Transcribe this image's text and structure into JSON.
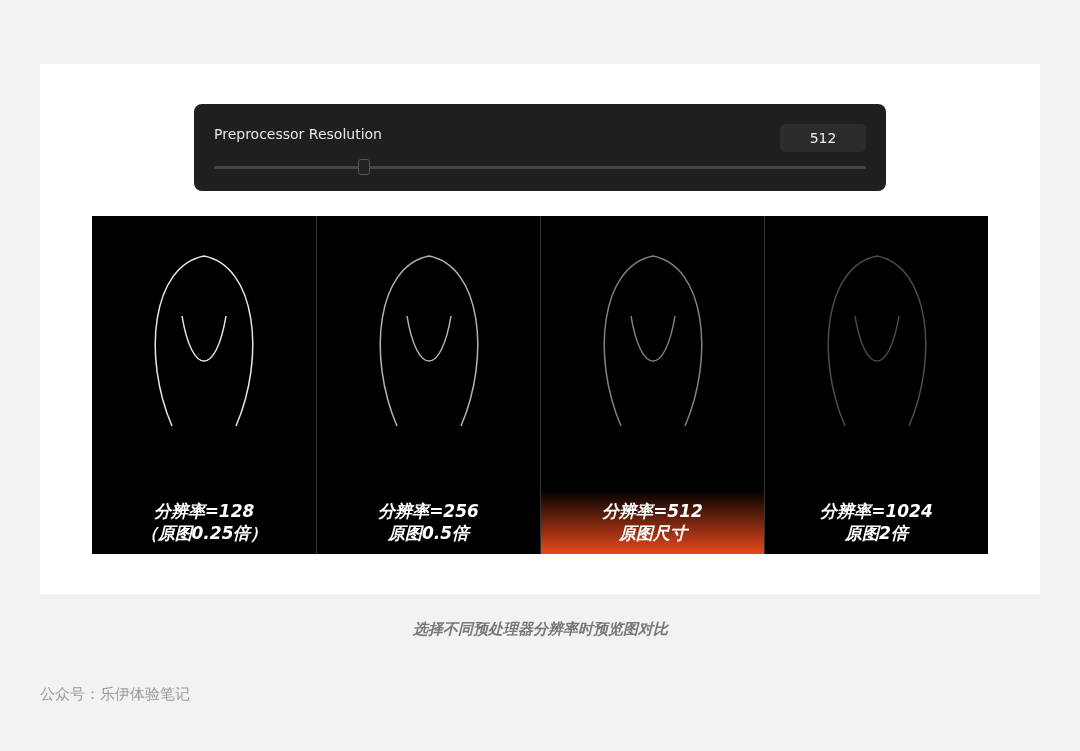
{
  "settings_panel": {
    "label": "Preprocessor Resolution",
    "value": "512",
    "slider": {
      "level": 0.23
    }
  },
  "previews": [
    {
      "line1": "分辨率=128",
      "line2": "（原图0.25倍）",
      "selected": false
    },
    {
      "line1": "分辨率=256",
      "line2": "原图0.5倍",
      "selected": false
    },
    {
      "line1": "分辨率=512",
      "line2": "原图尺寸",
      "selected": true
    },
    {
      "line1": "分辨率=1024",
      "line2": "原图2倍",
      "selected": false
    }
  ],
  "caption": "选择不同预处理器分辨率时预览图对比",
  "footer": "公众号：乐伊体验笔记"
}
